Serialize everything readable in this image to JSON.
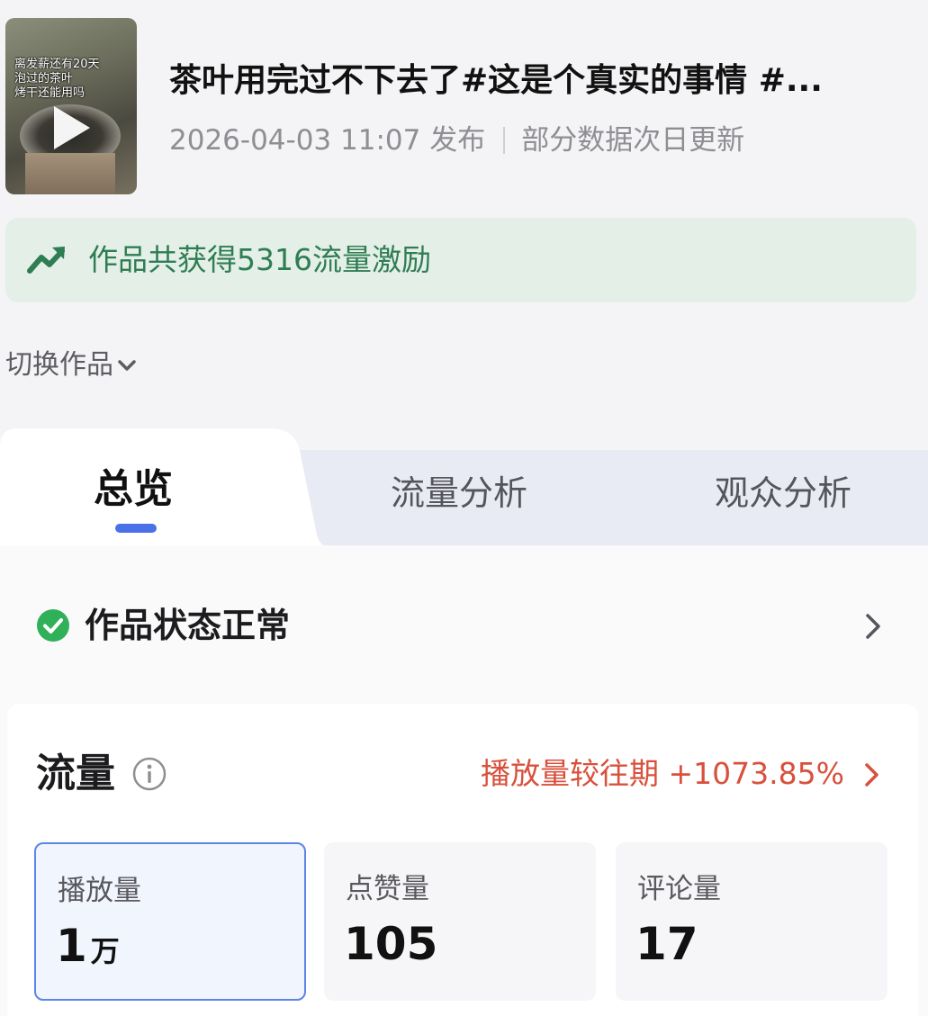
{
  "video": {
    "thumbnail_caption": [
      "离发薪还有20天",
      "泡过的茶叶",
      "烤干还能用吗"
    ],
    "title": "茶叶用完过不下去了#这是个真实的事情 #...",
    "publish_time": "2026-04-03 11:07 发布",
    "update_note": "部分数据次日更新"
  },
  "banner": {
    "text": "作品共获得5316流量激励",
    "icon": "trend-up-icon",
    "color": "#2f7d52"
  },
  "switch_work": {
    "label": "切换作品",
    "icon": "chevron-down-icon"
  },
  "tabs": [
    {
      "label": "总览",
      "active": true
    },
    {
      "label": "流量分析",
      "active": false
    },
    {
      "label": "观众分析",
      "active": false
    }
  ],
  "status": {
    "label": "作品状态正常",
    "icon": "check-circle-icon",
    "color": "#31b05a"
  },
  "traffic": {
    "title": "流量",
    "info_icon": "info-icon",
    "comparison": "播放量较往期 +1073.85%",
    "comparison_color": "#d9503c",
    "metrics": [
      {
        "label": "播放量",
        "value": "1",
        "unit": "万",
        "selected": true
      },
      {
        "label": "点赞量",
        "value": "105",
        "unit": "",
        "selected": false
      },
      {
        "label": "评论量",
        "value": "17",
        "unit": "",
        "selected": false
      }
    ]
  },
  "accent_color": "#4a72e8"
}
